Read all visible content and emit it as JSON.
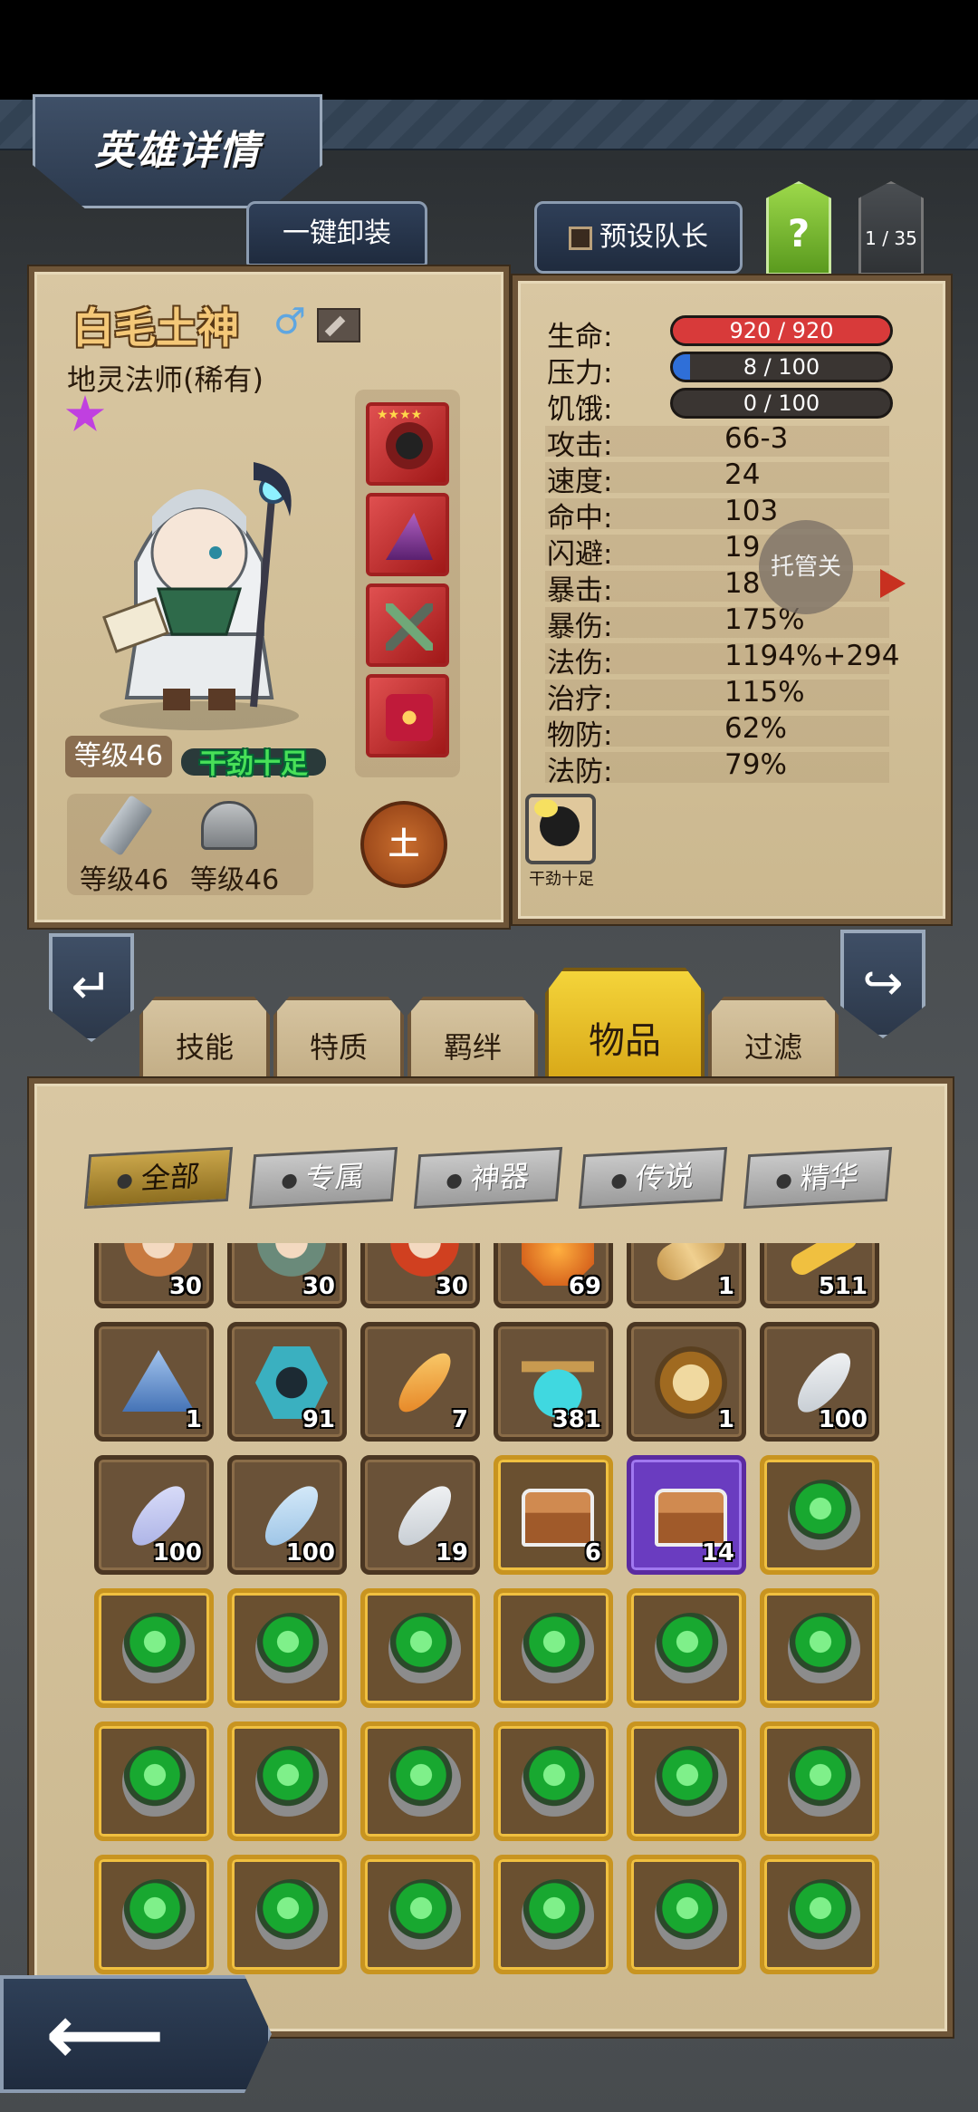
{
  "header": {
    "title": "英雄详情"
  },
  "top_buttons": {
    "unequip_all": "一键卸装",
    "preset_captain": "预设队长",
    "help": "?",
    "pager": "1 / 35"
  },
  "hero": {
    "name": "白毛土神",
    "gender_icon": "male-icon",
    "class": "地灵法师(稀有)",
    "rarity_stars": 1,
    "level": "等级46",
    "status": "干劲十足",
    "weapon_level": "等级46",
    "armor_level": "等级46",
    "element": "土",
    "equipment": [
      {
        "name": "spider-trinket-icon",
        "stars": "★★★★"
      },
      {
        "name": "wizard-hat-icon",
        "stars": ""
      },
      {
        "name": "cross-staff-icon",
        "stars": ""
      },
      {
        "name": "spellbook-icon",
        "stars": ""
      }
    ]
  },
  "stats": {
    "hp_label": "生命:",
    "hp_value": "920 / 920",
    "hp_fraction": 1.0,
    "hp_color": "#d83a3a",
    "stress_label": "压力:",
    "stress_value": "8 / 100",
    "stress_fraction": 0.08,
    "stress_color": "#2f6fd8",
    "hunger_label": "饥饿:",
    "hunger_value": "0 / 100",
    "hunger_fraction": 0.0,
    "rows": [
      {
        "label": "攻击:",
        "value": "66-3"
      },
      {
        "label": "速度:",
        "value": "24"
      },
      {
        "label": "命中:",
        "value": "103"
      },
      {
        "label": "闪避:",
        "value": "19"
      },
      {
        "label": "暴击:",
        "value": "18"
      },
      {
        "label": "暴伤:",
        "value": "175%"
      },
      {
        "label": "法伤:",
        "value": "1194%+294"
      },
      {
        "label": "治疗:",
        "value": "115%"
      },
      {
        "label": "物防:",
        "value": "62%"
      },
      {
        "label": "法防:",
        "value": "79%"
      }
    ],
    "floating_button": "托管关",
    "trait_label": "干劲十足"
  },
  "tabs": [
    "技能",
    "特质",
    "羁绊",
    "物品",
    "过滤"
  ],
  "active_tab": "物品",
  "filters": [
    "全部",
    "专属",
    "神器",
    "传说",
    "精华"
  ],
  "active_filter": "全部",
  "inventory": {
    "rows": [
      [
        {
          "icon": "hero-portrait-icon",
          "count": "30"
        },
        {
          "icon": "hero-portrait-icon",
          "count": "30"
        },
        {
          "icon": "hero-portrait-icon",
          "count": "30"
        },
        {
          "icon": "orange-gem-icon",
          "count": "69"
        },
        {
          "icon": "scroll-icon",
          "count": "1"
        },
        {
          "icon": "golden-key-icon",
          "count": "511"
        }
      ],
      [
        {
          "icon": "crystal-pile-icon",
          "count": "1"
        },
        {
          "icon": "dark-rune-icon",
          "count": "91"
        },
        {
          "icon": "golden-feather-icon",
          "count": "7"
        },
        {
          "icon": "potion-icon",
          "count": "381"
        },
        {
          "icon": "golden-shield-icon",
          "count": "1"
        },
        {
          "icon": "green-feather-icon",
          "count": "100"
        }
      ],
      [
        {
          "icon": "purple-feather-icon",
          "count": "100"
        },
        {
          "icon": "blue-feather-icon",
          "count": "100"
        },
        {
          "icon": "white-feather-icon",
          "count": "19"
        },
        {
          "icon": "gold-chest-icon",
          "count": "6"
        },
        {
          "icon": "purple-chest-icon",
          "count": "14"
        },
        {
          "icon": "green-orb-icon",
          "count": ""
        }
      ],
      [
        {
          "icon": "green-orb-icon",
          "count": ""
        },
        {
          "icon": "green-orb-icon",
          "count": ""
        },
        {
          "icon": "green-orb-icon",
          "count": ""
        },
        {
          "icon": "green-orb-icon",
          "count": ""
        },
        {
          "icon": "green-orb-icon",
          "count": ""
        },
        {
          "icon": "green-orb-icon",
          "count": ""
        }
      ],
      [
        {
          "icon": "green-orb-icon",
          "count": ""
        },
        {
          "icon": "green-orb-icon",
          "count": ""
        },
        {
          "icon": "green-orb-icon",
          "count": ""
        },
        {
          "icon": "green-orb-icon",
          "count": ""
        },
        {
          "icon": "green-orb-icon",
          "count": ""
        },
        {
          "icon": "green-orb-icon",
          "count": ""
        }
      ],
      [
        {
          "icon": "green-orb-icon",
          "count": ""
        },
        {
          "icon": "green-orb-icon",
          "count": ""
        },
        {
          "icon": "green-orb-icon",
          "count": ""
        },
        {
          "icon": "green-orb-icon",
          "count": ""
        },
        {
          "icon": "green-orb-icon",
          "count": ""
        },
        {
          "icon": "green-orb-icon",
          "count": ""
        }
      ]
    ]
  }
}
